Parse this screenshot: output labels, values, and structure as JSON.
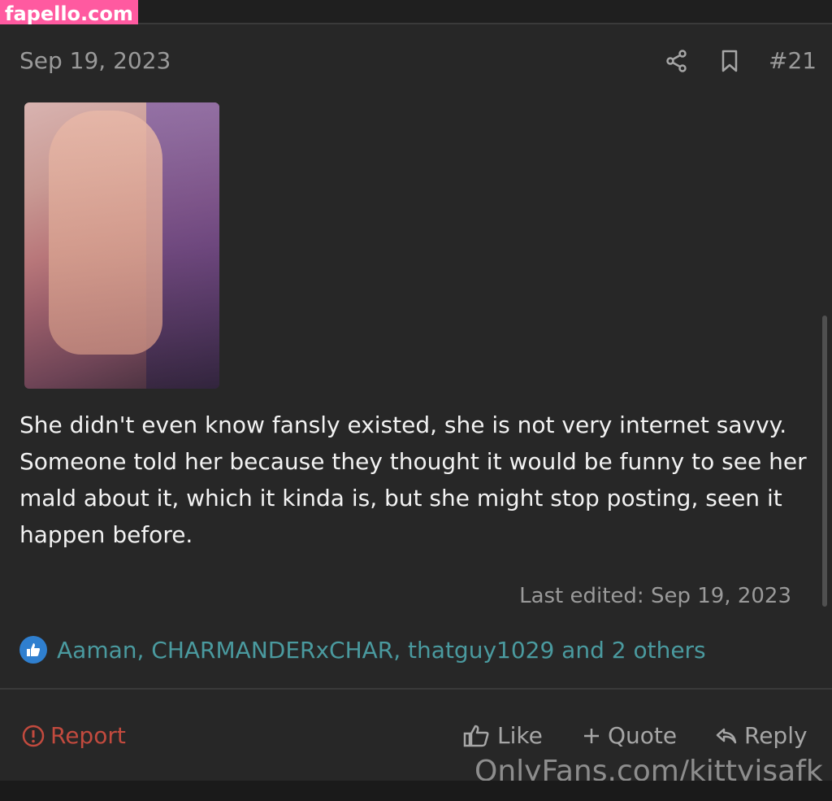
{
  "site": {
    "logo": "fapello.com"
  },
  "post": {
    "date": "Sep 19, 2023",
    "number": "#21",
    "body": "She didn't even know fansly existed, she is not very internet savvy. Someone told her because they thought it would be funny to see her mald about it, which it kinda is, but she might stop posting, seen it happen before.",
    "last_edited": "Last edited: Sep 19, 2023",
    "likers": "Aaman, CHARMANDERxCHAR, thatguy1029 and 2 others"
  },
  "actions": {
    "report": "Report",
    "like": "Like",
    "quote": "Quote",
    "reply": "Reply"
  },
  "watermark": "OnlyFans.com/kittyisafk",
  "colors": {
    "accent_link": "#4a9a9f",
    "report": "#c24a3e",
    "like_badge": "#2f7fcf",
    "logo_bg": "#ff5aa0"
  }
}
